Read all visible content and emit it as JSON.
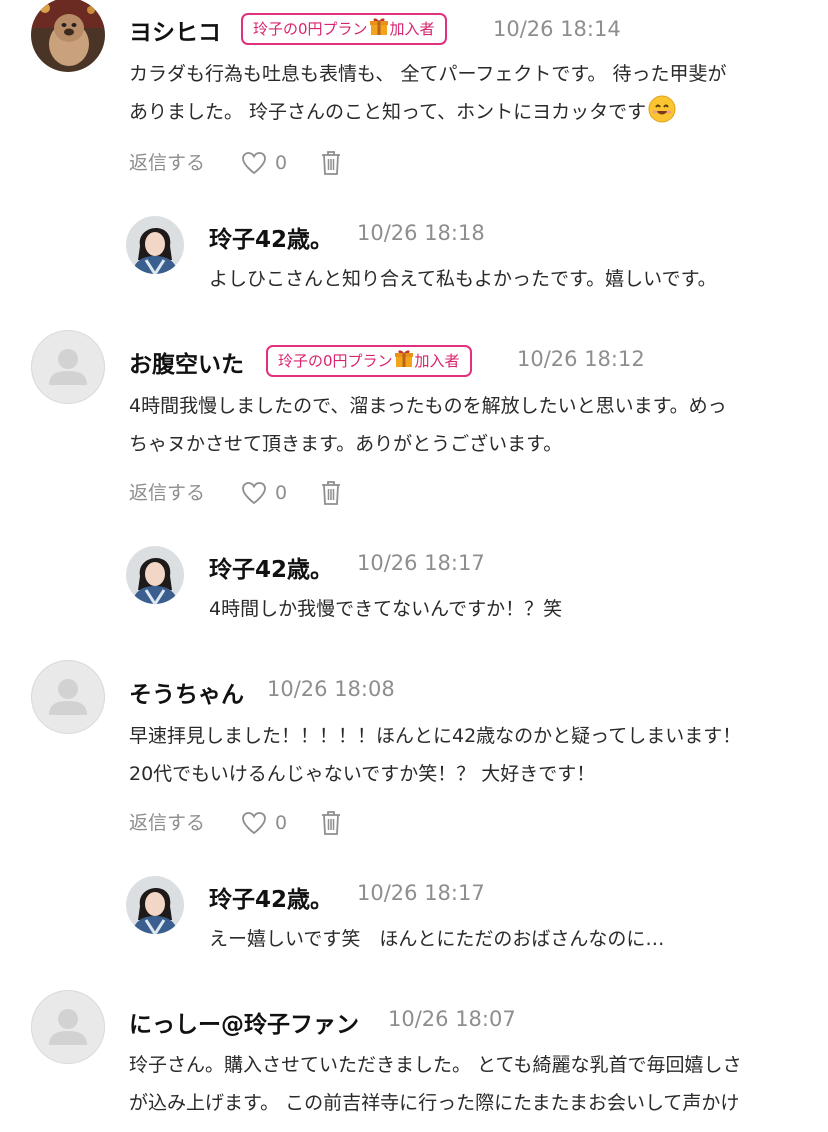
{
  "badge_label_pre": "玲子の0円プラン",
  "badge_label_post": "加入者",
  "reply_label": "返信する",
  "comments": [
    {
      "name": "ヨシヒコ",
      "time": "10/26 18:14",
      "lines": [
        "カラダも行為も吐息も表情も、 全てパーフェクトです。 待った甲斐が",
        "ありました。 玲子さんのこと知って、ホントにヨカッタです"
      ],
      "likes": "0",
      "reply": {
        "name": "玲子42歳。",
        "time": "10/26 18:18",
        "text": "よしひこさんと知り合えて私もよかったです。嬉しいです。"
      }
    },
    {
      "name": "お腹空いた",
      "time": "10/26 18:12",
      "lines": [
        "4時間我慢しましたので、溜まったものを解放したいと思います。めっ",
        "ちゃヌかさせて頂きます。ありがとうございます。"
      ],
      "likes": "0",
      "reply": {
        "name": "玲子42歳。",
        "time": "10/26 18:17",
        "text": "4時間しか我慢できてないんですか！？笑"
      }
    },
    {
      "name": "そうちゃん",
      "time": "10/26 18:08",
      "lines": [
        "早速拝見しました！！！！！ほんとに42歳なのかと疑ってしまいます！",
        "20代でもいけるんじゃないですか笑！？ 大好きです！"
      ],
      "likes": "0",
      "reply": {
        "name": "玲子42歳。",
        "time": "10/26 18:17",
        "text": "えー嬉しいです笑　ほんとにただのおばさんなのに…"
      }
    },
    {
      "name": "にっしー@玲子ファン",
      "time": "10/26 18:07",
      "lines": [
        "玲子さん。購入させていただきました。 とても綺麗な乳首で毎回嬉しさ",
        "が込み上げます。 この前吉祥寺に行った際にたまたまお会いして声かけ"
      ]
    }
  ],
  "colors": {
    "badge": "#e0307e",
    "muted": "#8e8e8e",
    "text": "#2a2a2a"
  }
}
